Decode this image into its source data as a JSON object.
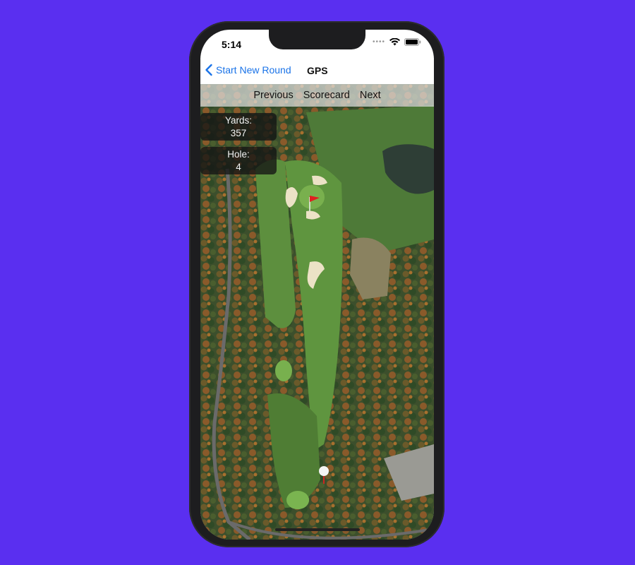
{
  "status_bar": {
    "time": "5:14"
  },
  "nav": {
    "back_label": "Start New Round",
    "title": "GPS"
  },
  "toolbar": {
    "previous": "Previous",
    "scorecard": "Scorecard",
    "next": "Next"
  },
  "yards": {
    "label": "Yards:",
    "value": "357"
  },
  "hole": {
    "label": "Hole:",
    "value": "4"
  },
  "colors": {
    "background": "#5a2ff0",
    "accent": "#1a73e8",
    "flag": "#e02020"
  },
  "icons": [
    "chevron-left-icon",
    "wifi-icon",
    "battery-icon",
    "flag-icon",
    "golf-ball-icon"
  ]
}
